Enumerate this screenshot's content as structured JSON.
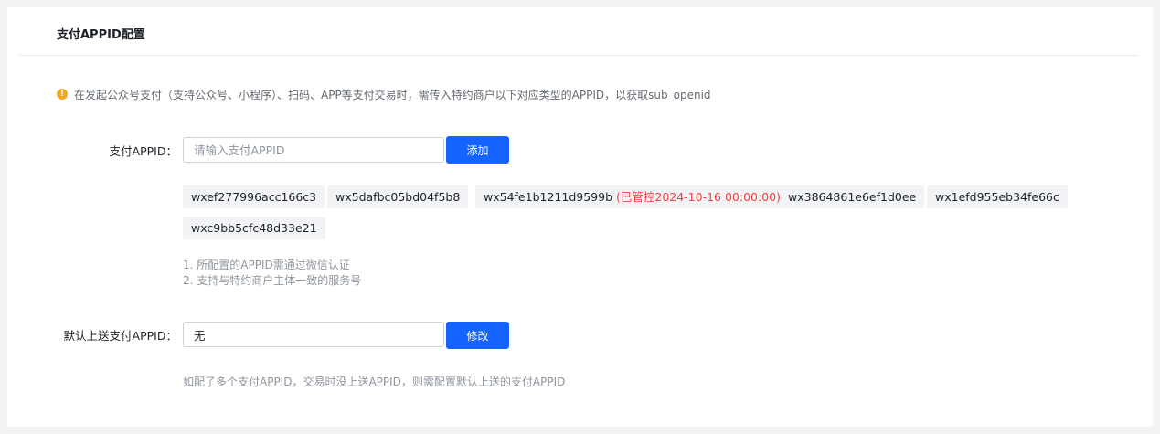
{
  "card": {
    "title": "支付APPID配置"
  },
  "notice": {
    "icon": "warning-circle-icon",
    "icon_glyph": "!",
    "icon_color": "#f5a623",
    "text": "在发起公众号支付（支持公众号、小程序）、扫码、APP等支付交易时，需传入特约商户以下对应类型的APPID，以获取sub_openid"
  },
  "appid_form": {
    "label": "支付APPID：",
    "input_placeholder": "请输入支付APPID",
    "input_value": "",
    "add_button_label": "添加"
  },
  "appid_tags": [
    {
      "appid": "wxef277996acc166c3",
      "status": ""
    },
    {
      "appid": "wx5dafbc05bd04f5b8",
      "status": ""
    },
    {
      "appid": "wx54fe1b1211d9599b",
      "status": "(已管控2024-10-16 00:00:00)"
    },
    {
      "appid": "wx3864861e6ef1d0ee",
      "status": ""
    },
    {
      "appid": "wx1efd955eb34fe66c",
      "status": ""
    },
    {
      "appid": "wxc9bb5cfc48d33e21",
      "status": ""
    }
  ],
  "rules": [
    "1. 所配置的APPID需通过微信认证",
    "2. 支持与特约商户主体一致的服务号"
  ],
  "default_form": {
    "label": "默认上送支付APPID：",
    "input_value": "无",
    "modify_button_label": "修改"
  },
  "hint": "如配了多个支付APPID，交易时没上送APPID，则需配置默认上送的支付APPID",
  "colors": {
    "primary": "#1664ff",
    "danger": "#f53f3f",
    "warning": "#f5a623",
    "tag_bg": "#f2f3f5"
  }
}
